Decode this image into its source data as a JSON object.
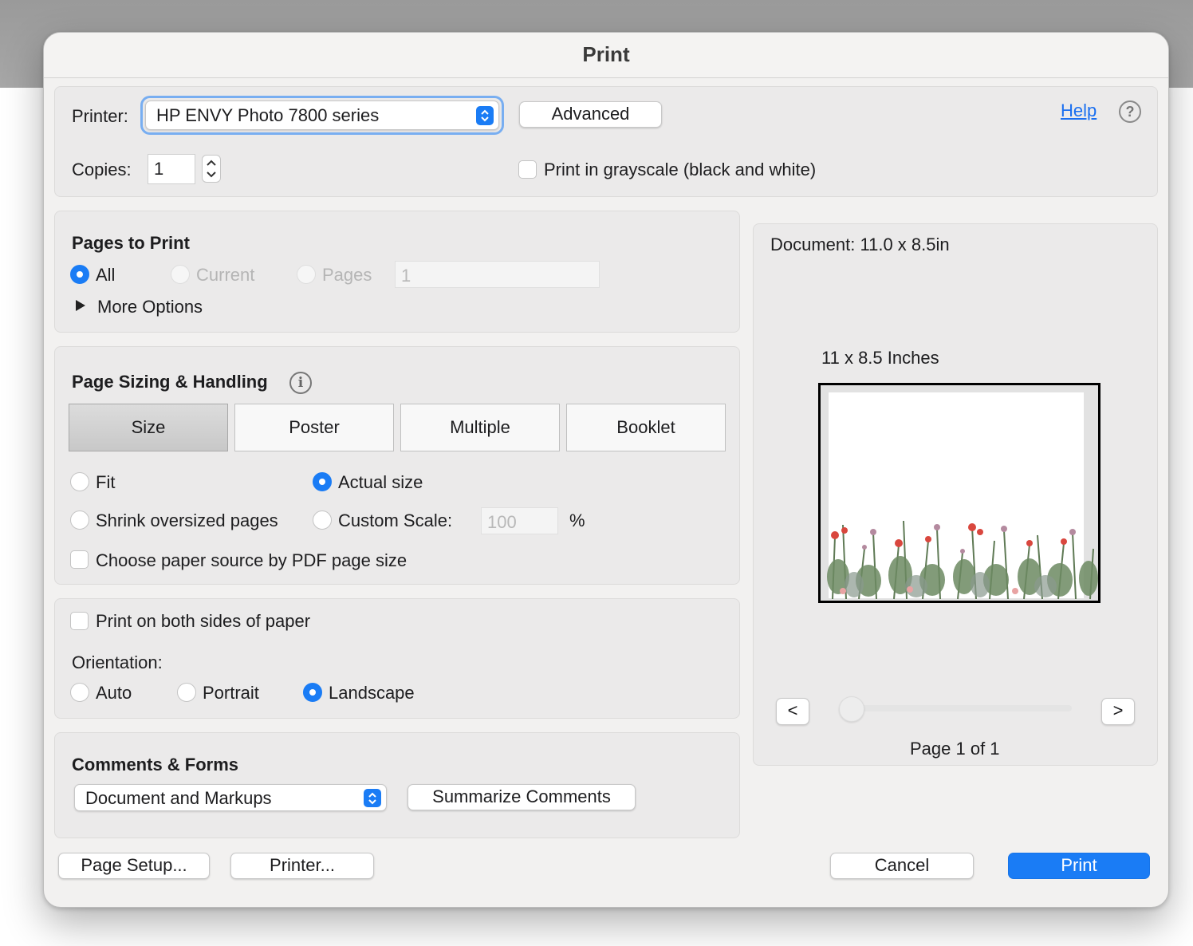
{
  "dialog": {
    "title": "Print"
  },
  "top": {
    "printer_label": "Printer:",
    "printer_value": "HP ENVY Photo 7800 series",
    "advanced_label": "Advanced",
    "help_label": "Help",
    "copies_label": "Copies:",
    "copies_value": "1",
    "grayscale_label": "Print in grayscale (black and white)",
    "grayscale_checked": false
  },
  "pages_to_print": {
    "heading": "Pages to Print",
    "options": [
      {
        "label": "All",
        "selected": true,
        "enabled": true
      },
      {
        "label": "Current",
        "selected": false,
        "enabled": false
      },
      {
        "label": "Pages",
        "selected": false,
        "enabled": false
      }
    ],
    "pages_value": "1",
    "more_options_label": "More Options"
  },
  "page_sizing": {
    "heading": "Page Sizing & Handling",
    "tabs": [
      "Size",
      "Poster",
      "Multiple",
      "Booklet"
    ],
    "selected_tab": "Size",
    "fit_label": "Fit",
    "actual_size_label": "Actual size",
    "shrink_label": "Shrink oversized pages",
    "custom_scale_label": "Custom Scale:",
    "custom_scale_value": "100",
    "percent_label": "%",
    "selected_option": "Actual size",
    "paper_source_label": "Choose paper source by PDF page size"
  },
  "orientation": {
    "both_sides_label": "Print on both sides of paper",
    "heading": "Orientation:",
    "options": [
      "Auto",
      "Portrait",
      "Landscape"
    ],
    "selected": "Landscape"
  },
  "comments": {
    "heading": "Comments & Forms",
    "value": "Document and Markups",
    "summarize_label": "Summarize Comments"
  },
  "preview": {
    "document_label": "Document: 11.0 x 8.5in",
    "paper_label": "11 x 8.5 Inches",
    "prev_label": "<",
    "next_label": ">",
    "page_label": "Page 1 of 1",
    "slider_position": 0
  },
  "footer": {
    "page_setup_label": "Page Setup...",
    "printer_label": "Printer...",
    "cancel_label": "Cancel",
    "print_label": "Print"
  },
  "colors": {
    "accent": "#1a7cf5",
    "link": "#1a6ff0",
    "panel": "#ebeaea"
  }
}
